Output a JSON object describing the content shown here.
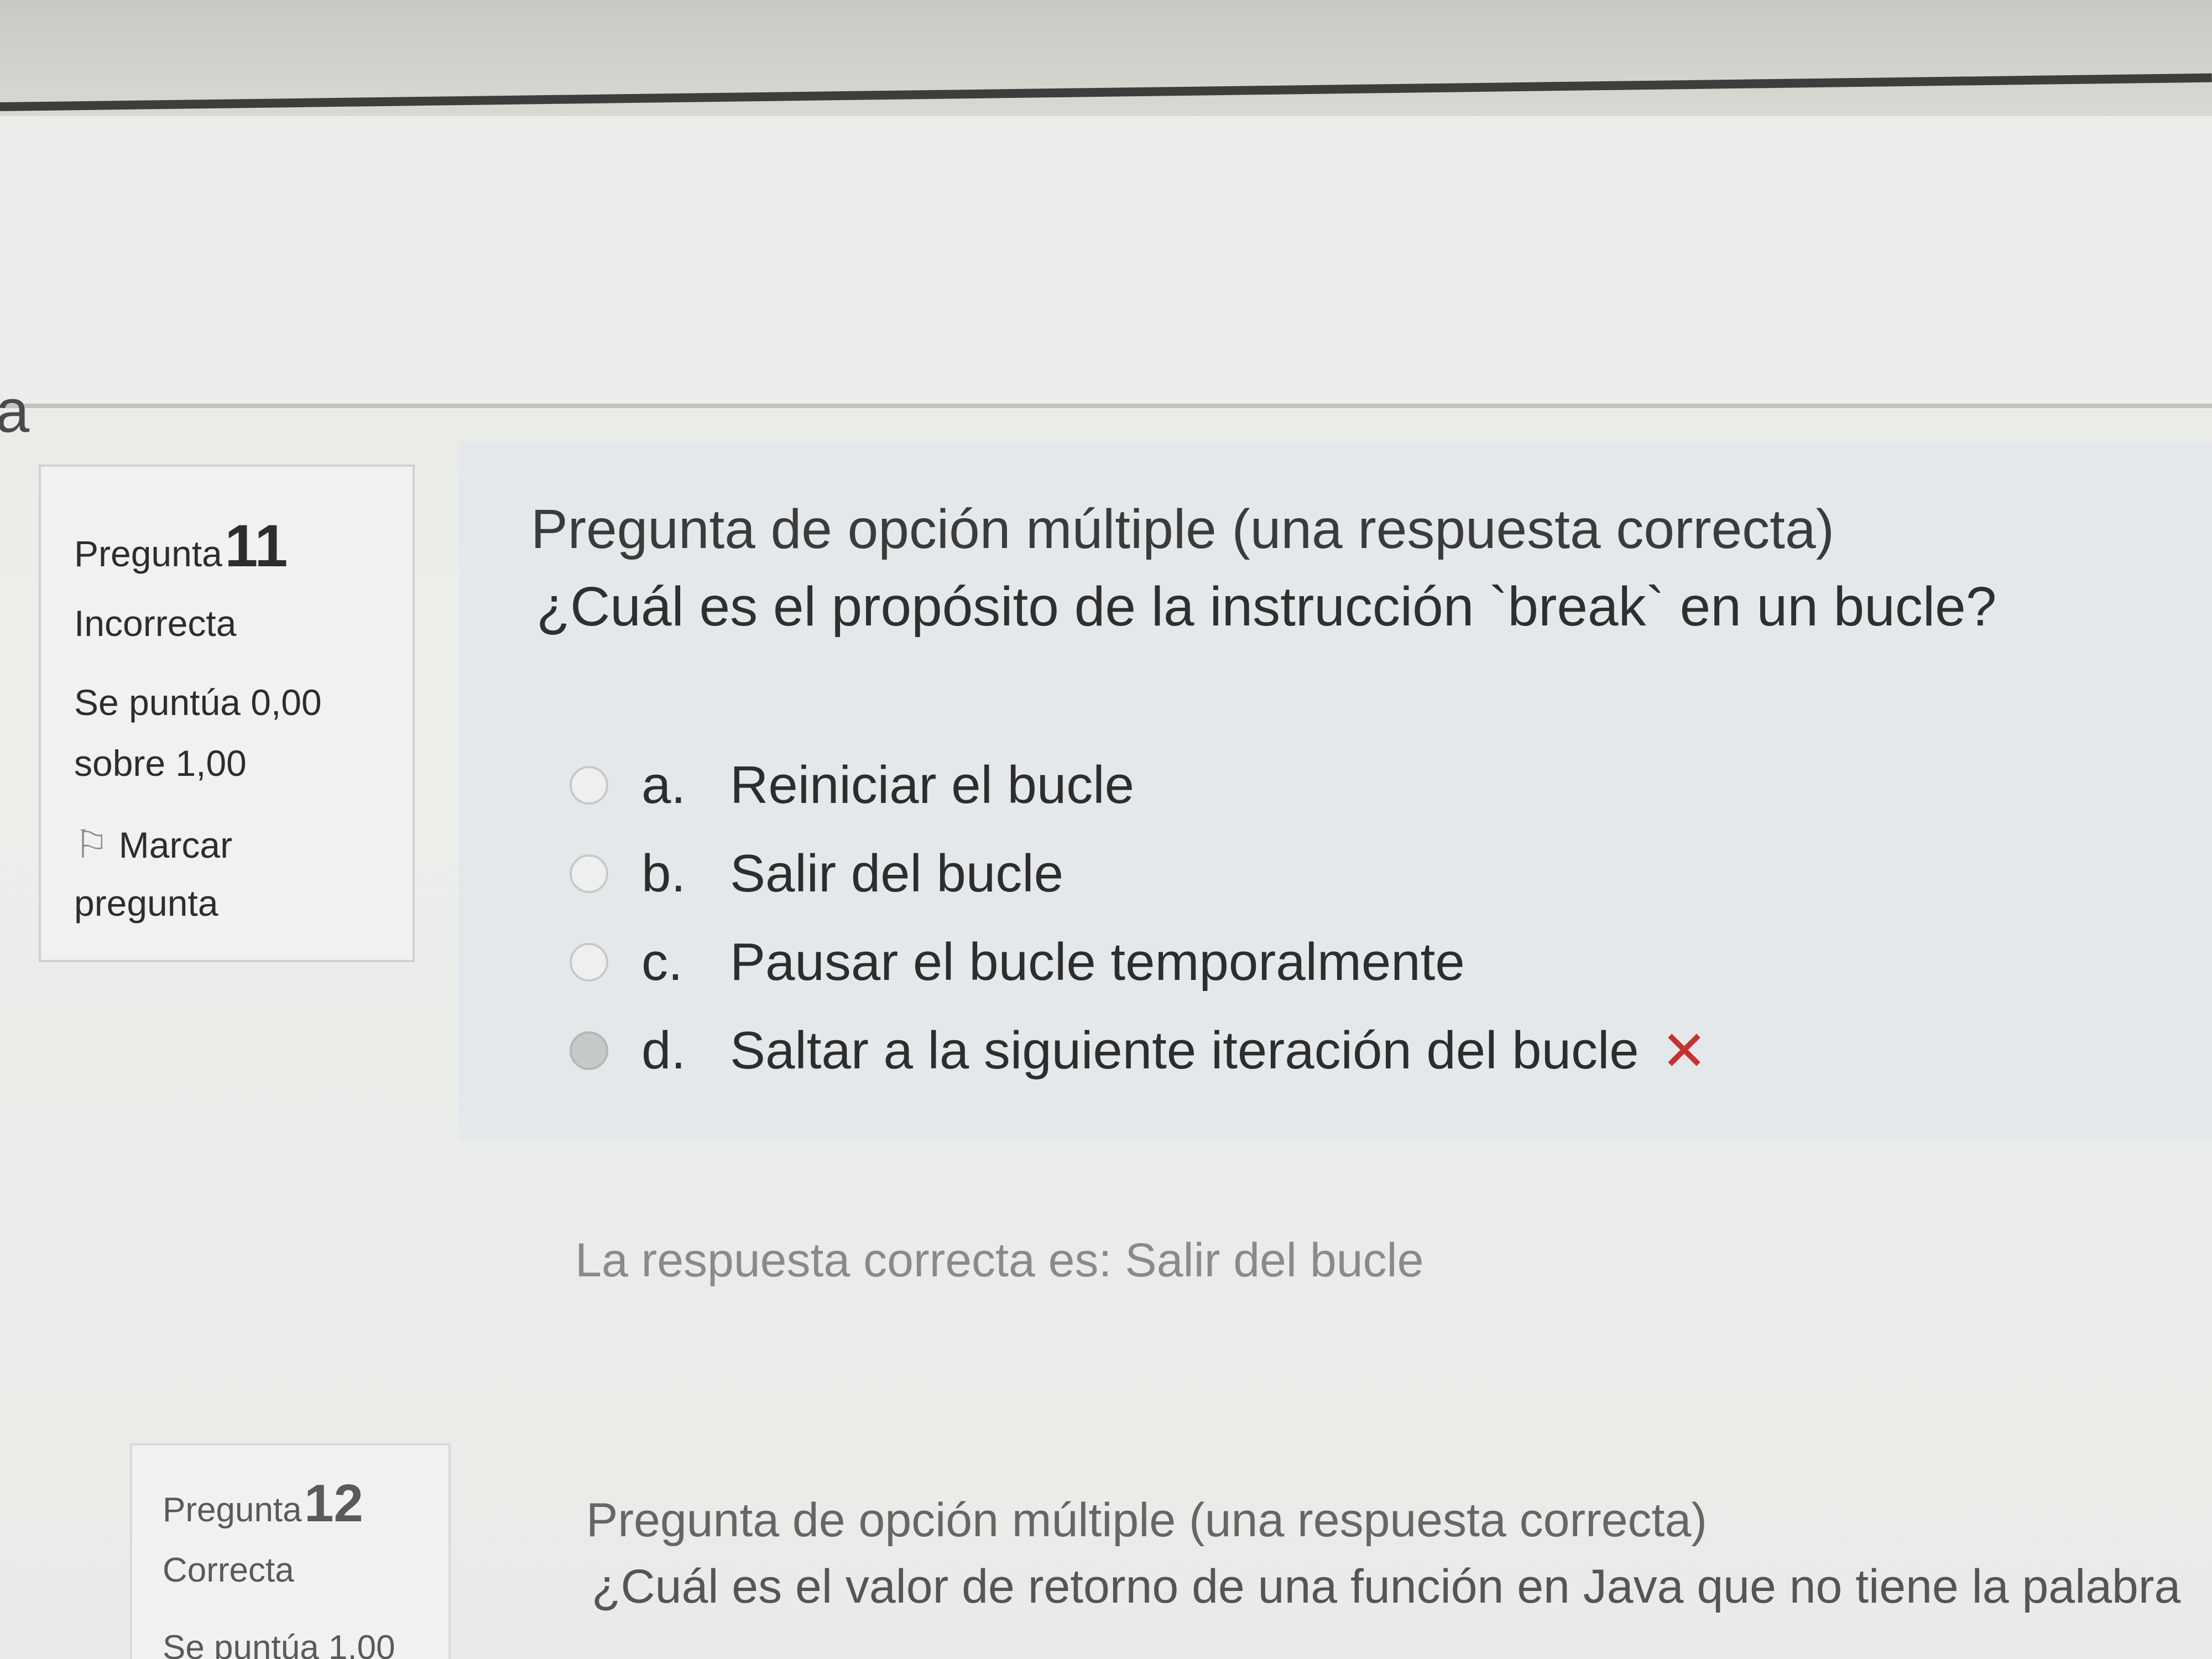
{
  "header": {
    "partial_letter": "a"
  },
  "question11": {
    "label": "Pregunta",
    "number": "11",
    "state": "Incorrecta",
    "grade_line1": "Se puntúa 0,00",
    "grade_line2": "sobre 1,00",
    "flag_label_line1": "Marcar",
    "flag_label_line2": "pregunta",
    "type": "Pregunta de opción múltiple (una respuesta correcta)",
    "text": "¿Cuál es el propósito de la instrucción `break` en un bucle?",
    "options": [
      {
        "letter": "a.",
        "text": "Reiniciar el bucle",
        "selected": false
      },
      {
        "letter": "b.",
        "text": "Salir del bucle",
        "selected": false
      },
      {
        "letter": "c.",
        "text": "Pausar el bucle temporalmente",
        "selected": false
      },
      {
        "letter": "d.",
        "text": "Saltar a la siguiente iteración del bucle",
        "selected": true
      }
    ],
    "wrong_mark": "✕",
    "feedback": "La respuesta correcta es: Salir del bucle"
  },
  "question12": {
    "label": "Pregunta",
    "number": "12",
    "state": "Correcta",
    "grade_line1": "Se puntúa 1,00",
    "type": "Pregunta de opción múltiple (una respuesta correcta)",
    "text": "¿Cuál es el valor de retorno de una función en Java que no tiene la palabra"
  },
  "colors": {
    "wrong": "#c9302c",
    "content_bg": "#e3e9ea",
    "info_bg": "#f1f2f0"
  }
}
